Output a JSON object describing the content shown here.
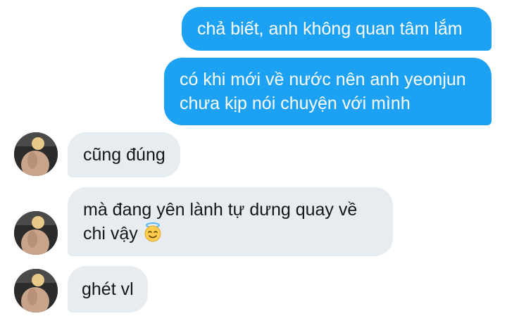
{
  "messages": [
    {
      "direction": "outgoing",
      "lines": [
        "chả biết, anh không quan tâm lắm"
      ]
    },
    {
      "direction": "outgoing",
      "lines": [
        "có khi mới về nước nên anh yeonjun",
        "chưa kịp nói chuyện với mình"
      ]
    },
    {
      "direction": "incoming",
      "lines": [
        "cũng đúng"
      ]
    },
    {
      "direction": "incoming",
      "lines": [
        "mà đang yên lành tự dưng quay về",
        "chi vậy"
      ],
      "emoji": "smiling-face-with-halo-icon"
    },
    {
      "direction": "incoming",
      "lines": [
        "ghét vl"
      ]
    }
  ],
  "colors": {
    "outgoing_bubble": "#1da1f2",
    "incoming_bubble": "#e6ecf0",
    "outgoing_text": "#ffffff",
    "incoming_text": "#14171a"
  }
}
